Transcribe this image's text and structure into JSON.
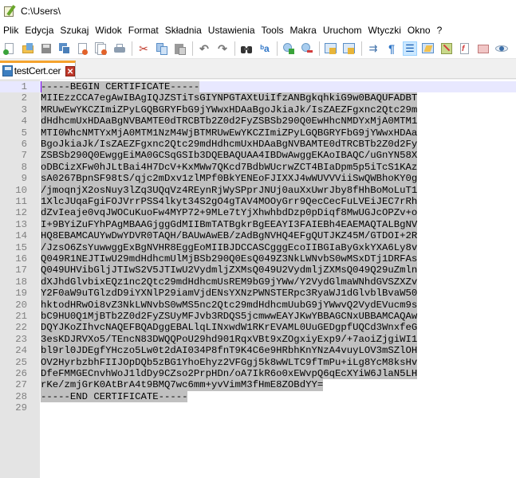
{
  "window": {
    "title": "C:\\Users\\"
  },
  "menu": [
    "Plik",
    "Edycja",
    "Szukaj",
    "Widok",
    "Format",
    "Składnia",
    "Ustawienia",
    "Tools",
    "Makra",
    "Uruchom",
    "Wtyczki",
    "Okno",
    "?"
  ],
  "toolbar": {
    "groups": [
      [
        "new-file",
        "open-file",
        "save",
        "save-all",
        "close",
        "close-all",
        "print"
      ],
      [
        "cut",
        "copy",
        "paste"
      ],
      [
        "undo",
        "redo"
      ],
      [
        "find",
        "replace"
      ],
      [
        "zoom-in",
        "zoom-out"
      ],
      [
        "sync-vertical",
        "sync-horizontal"
      ],
      [
        "word-wrap",
        "show-all-characters",
        "indent-guide",
        "user-defined-language",
        "document-map",
        "function-list",
        "folder-as-workspace",
        "monitoring"
      ]
    ],
    "active": "indent-guide"
  },
  "tabs": [
    {
      "label": "testCert.cer",
      "active": true
    }
  ],
  "editor": {
    "current_line": 1,
    "lines": [
      "-----BEGIN CERTIFICATE-----",
      "MIIEzzCCA7egAwIBAgIQJZSTiTsGIYNPGTAXtUiIfzANBgkqhkiG9w0BAQUFADBT",
      "MRUwEwYKCZImiZPyLGQBGRYFbG9jYWwxHDAaBgoJkiaJk/IsZAEZFgxnc2Qtc29m",
      "dHdhcmUxHDAaBgNVBAMTE0dTRCBTb2Z0d2FyZSBSb290Q0EwHhcNMDYxMjA0MTM1",
      "MTI0WhcNMTYxMjA0MTM1NzM4WjBTMRUwEwYKCZImiZPyLGQBGRYFbG9jYWwxHDAa",
      "BgoJkiaJk/IsZAEZFgxnc2Qtc29mdHdhcmUxHDAaBgNVBAMTE0dTRCBTb2Z0d2Fy",
      "ZSBSb290Q0EwggEiMA0GCSqGSIb3DQEBAQUAA4IBDwAwggEKAoIBAQC/uGnYN58X",
      "oDBCizXFw0hJLtBai4H7DcV+KxMWw7QKcd7BdbWUcrwZCT4BIaDpm5p5iTcS1KAz",
      "sA0267BpnSF98tS/qjc2mDxv1zlMPf0BkYENEoFJIXXJ4wWUVVViiSwQWBhoKY0g",
      "/jmoqnjX2osNuy3lZq3UQqVz4REynRjWySPprJNUj0auXxUwrJby8fHhBoMoLuT1",
      "1XlcJUqaFgiFOJVrrPSS4lkyt34S2gO4gTAV4MOOyGrr9QecCecFuLVEiJEC7rRh",
      "dZvIeaje0vqJWOCuKuoFw4MYP72+9MLe7tYjXhwhbdDzp0pDiqf8MwUGJcOPZv+o",
      "I+9BYiZuFYhPAgMBAAGjggGdMIIBmTATBgkrBgEEAYI3FAIEBh4EAEMAQTALBgNV",
      "HQ8EBAMCAUYwDwYDVR0TAQH/BAUwAwEB/zAdBgNVHQ4EFgQUTJKZ45M/GTDOI+2R",
      "/JzsO6ZsYuwwggExBgNVHR8EggEoMIIBJDCCASCgggEcoIIBGIaByGxkYXA6Ly8v",
      "Q049R1NEJTIwU29mdHdhcmUlMjBSb290Q0EsQ049Z3NkLWNvbS0wMSxDTj1DRFAs",
      "Q049UHVibGljJTIwS2V5JTIwU2VydmljZXMsQ049U2VydmljZXMsQ049Q29uZmln",
      "dXJhdGlvbixEQz1nc2Qtc29mdHdhcmUsREM9bG9jYWw/Y2VydGlmaWNhdGVSZXZv",
      "Y2F0aW9uTGlzdD9iYXNlP29iamVjdENsYXNzPWNSTERpc3RyaWJ1dGlvblBvaW50",
      "hktodHRwOi8vZ3NkLWNvbS0wMS5nc2Qtc29mdHdhcmUubG9jYWwvQ2VydEVucm9s",
      "bC9HU0Q1MjBTb2Z0d2FyZSUyMFJvb3RDQS5jcmwwEAYJKwYBBAGCNxUBBAMCAQAw",
      "DQYJKoZIhvcNAQEFBQADggEBALlqLINxwdW1RKrEVAML0UuGEDgpfUQCd3WnxfeG",
      "3esKDJRVXo5/TEncN83DWQQPoU29hd901RqxVBt9xZOgxiyExp9/+7aoiZjgiWI1",
      "bl9rl0JDEgfYHczo5Lw0t2dAI034P8fnT9K4C6e9HRbhKnYNzA4vuyLOV3mSZlOH",
      "OV2HyrbzbhFIIJOpDQb5zBG1YhoEhyz2VFGgj5k8wWLTC9fTmPu+iLg8YcM8ksHv",
      "DfeFMMGECnvhWoJ1ldDy9CZso2PrpHDn/oA7IkR6o0xEWvpQ6qEcXYiW6JlaN5LH",
      "rKe/zmjGrK0AtBrA4t9BMQ7wc6mm+yvVimM3fHmE8ZOBdYY=",
      "-----END CERTIFICATE-----",
      ""
    ],
    "line_numbers": [
      "1",
      "2",
      "3",
      "4",
      "5",
      "6",
      "7",
      "8",
      "9",
      "10",
      "11",
      "12",
      "13",
      "14",
      "15",
      "16",
      "17",
      "18",
      "19",
      "20",
      "21",
      "22",
      "23",
      "24",
      "25",
      "26",
      "27",
      "28",
      "29"
    ]
  },
  "colors": {
    "selection": "#c0c0c0",
    "gutter": "#e4e4e4",
    "line_numbers": "#808080",
    "current_line": "#e8e8ff",
    "caret": "#8000ff",
    "tab_accent": "#f5a32d",
    "tab_close": "#c0392b"
  }
}
